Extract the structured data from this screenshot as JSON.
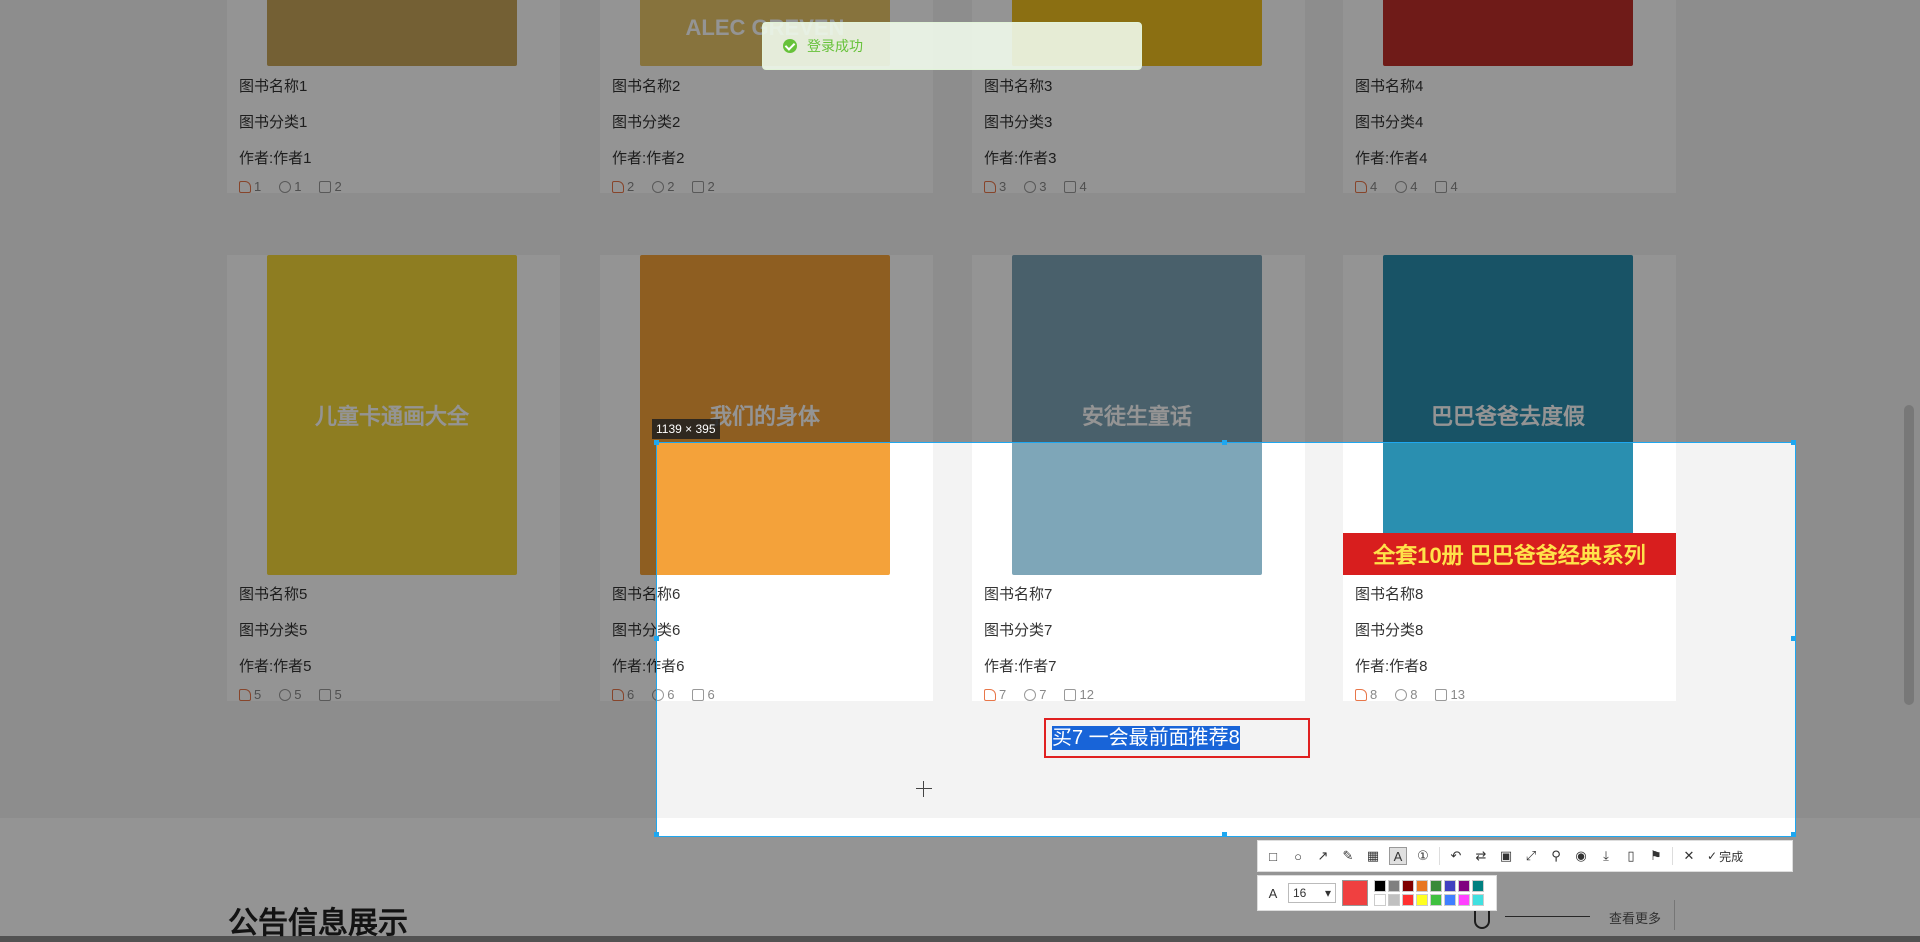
{
  "toast": {
    "message": "登录成功"
  },
  "books_row1": [
    {
      "name": "图书名称1",
      "category": "图书分类1",
      "author": "作者:作者1",
      "likes": "1",
      "stars": "1",
      "comments": "2",
      "cover_color": "#c9a55a"
    },
    {
      "name": "图书名称2",
      "category": "图书分类2",
      "author": "作者:作者2",
      "likes": "2",
      "stars": "2",
      "comments": "2",
      "cover_color": "#e8c66a",
      "cover_text": "ALEC GREVEN"
    },
    {
      "name": "图书名称3",
      "category": "图书分类3",
      "author": "作者:作者3",
      "likes": "3",
      "stars": "3",
      "comments": "4",
      "cover_color": "#f0c020"
    },
    {
      "name": "图书名称4",
      "category": "图书分类4",
      "author": "作者:作者4",
      "likes": "4",
      "stars": "4",
      "comments": "4",
      "cover_color": "#c0302a"
    }
  ],
  "books_row2": [
    {
      "name": "图书名称5",
      "category": "图书分类5",
      "author": "作者:作者5",
      "likes": "5",
      "stars": "5",
      "comments": "5",
      "cover_color": "#f5d83a",
      "cover_text": "儿童卡通画大全"
    },
    {
      "name": "图书名称6",
      "category": "图书分类6",
      "author": "作者:作者6",
      "likes": "6",
      "stars": "6",
      "comments": "6",
      "cover_color": "#f4a23a",
      "cover_text": "我们的身体"
    },
    {
      "name": "图书名称7",
      "category": "图书分类7",
      "author": "作者:作者7",
      "likes": "7",
      "stars": "7",
      "comments": "12",
      "cover_color": "#7ea6b8",
      "cover_text": "安徒生童话"
    },
    {
      "name": "图书名称8",
      "category": "图书分类8",
      "author": "作者:作者8",
      "likes": "8",
      "stars": "8",
      "comments": "13",
      "cover_color": "#2a8fb0",
      "cover_text": "巴巴爸爸去度假",
      "banner": "全套10册 巴巴爸爸经典系列"
    }
  ],
  "screenshot_tool": {
    "size_label": "1139 × 395",
    "annotation_text": "买7  一会最前面推荐8",
    "font_size": "16",
    "current_color": "#f04040",
    "done_label": "完成",
    "tools": [
      "rectangle-icon",
      "ellipse-icon",
      "arrow-icon",
      "pencil-icon",
      "mosaic-icon",
      "text-icon",
      "number-icon",
      "undo-icon",
      "redo-icon",
      "ocr-icon",
      "scroll-capture-icon",
      "pin-icon",
      "record-icon",
      "save-icon",
      "phone-icon",
      "bookmark-icon",
      "close-icon",
      "check-icon"
    ],
    "palette": [
      "#000000",
      "#808080",
      "#800000",
      "#e87722",
      "#3a8a3a",
      "#4040c0",
      "#800080",
      "#008080",
      "#ffffff",
      "#c0c0c0",
      "#ff3030",
      "#ffff20",
      "#40c040",
      "#4080ff",
      "#ff40ff",
      "#40e0e0"
    ]
  },
  "notice_section": {
    "title": "公告信息展示",
    "more": "查看更多"
  }
}
